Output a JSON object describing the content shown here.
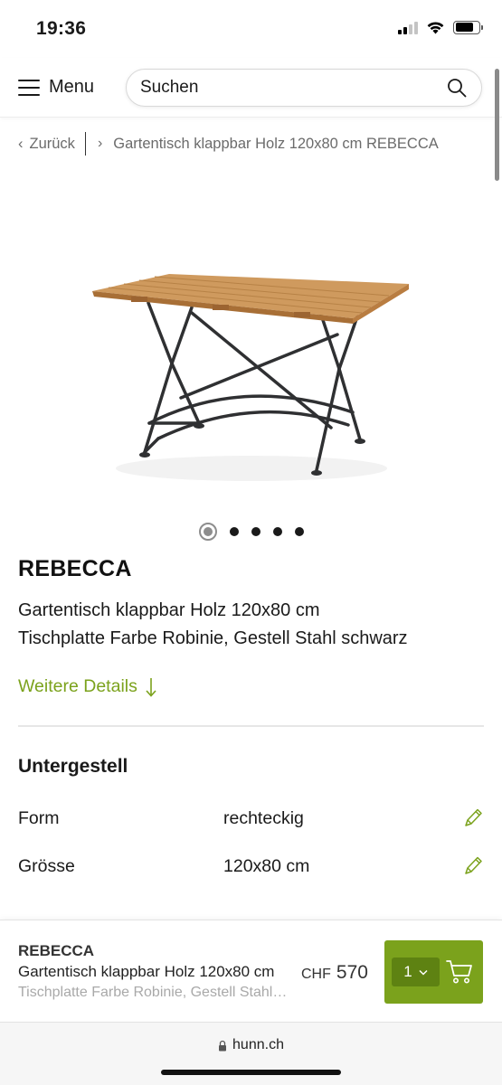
{
  "status": {
    "time": "19:36",
    "signal_icon": "cellular-signal-icon",
    "wifi_icon": "wifi-icon",
    "battery_icon": "battery-icon"
  },
  "header": {
    "menu_label": "Menu",
    "menu_icon": "hamburger-icon",
    "search_placeholder": "Suchen",
    "search_icon": "search-icon"
  },
  "breadcrumb": {
    "back_label": "Zurück",
    "current": "Gartentisch klappbar Holz 120x80 cm REBECCA"
  },
  "product": {
    "image_alt": "Klapptisch mit Holzplatte und schwarzem Stahlgestell",
    "carousel": {
      "count": 5,
      "active": 1
    },
    "brand": "REBECCA",
    "description_line1": "Gartentisch klappbar Holz 120x80 cm",
    "description_line2": "Tischplatte Farbe Robinie, Gestell Stahl schwarz",
    "more_details": "Weitere Details",
    "more_details_icon": "arrow-down-icon"
  },
  "specs": {
    "section_title": "Untergestell",
    "rows": [
      {
        "key": "Form",
        "value": "rechteckig",
        "icon": "pencil-icon"
      },
      {
        "key": "Grösse",
        "value": "120x80 cm",
        "icon": "pencil-icon"
      }
    ]
  },
  "cart_bar": {
    "brand": "REBECCA",
    "title": "Gartentisch klappbar Holz 120x80 cm",
    "subtitle": "Tischplatte Farbe Robinie, Gestell Stahl schwarz",
    "currency": "CHF",
    "price": "570",
    "quantity": "1",
    "cart_icon": "shopping-cart-icon"
  },
  "browser": {
    "url": "hunn.ch",
    "lock_icon": "lock-icon"
  },
  "colors": {
    "accent_green": "#7ba21c",
    "accent_green_dark": "#5e8212",
    "text": "#1a1a1a",
    "muted": "#6b6b6b"
  }
}
